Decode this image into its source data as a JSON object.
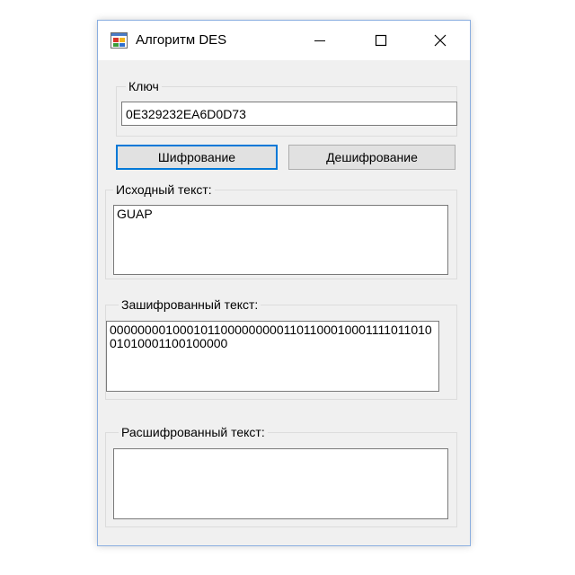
{
  "window": {
    "title": "Алгоритм DES"
  },
  "key_group": {
    "label": "Ключ",
    "value": "0E329232EA6D0D73"
  },
  "buttons": {
    "encrypt_label": "Шифрование",
    "decrypt_label": "Дешифрование"
  },
  "source_group": {
    "label": "Исходный текст:",
    "value": "GUAP"
  },
  "encrypted_group": {
    "label": "Зашифрованный текст:",
    "value": "0000000010001011000000000110110001000111101101001010001100100000"
  },
  "decrypted_group": {
    "label": "Расшифрованный текст:",
    "value": ""
  },
  "colors": {
    "accent": "#0078d7",
    "window_bg": "#f0f0f0",
    "border": "#8aaee0"
  }
}
